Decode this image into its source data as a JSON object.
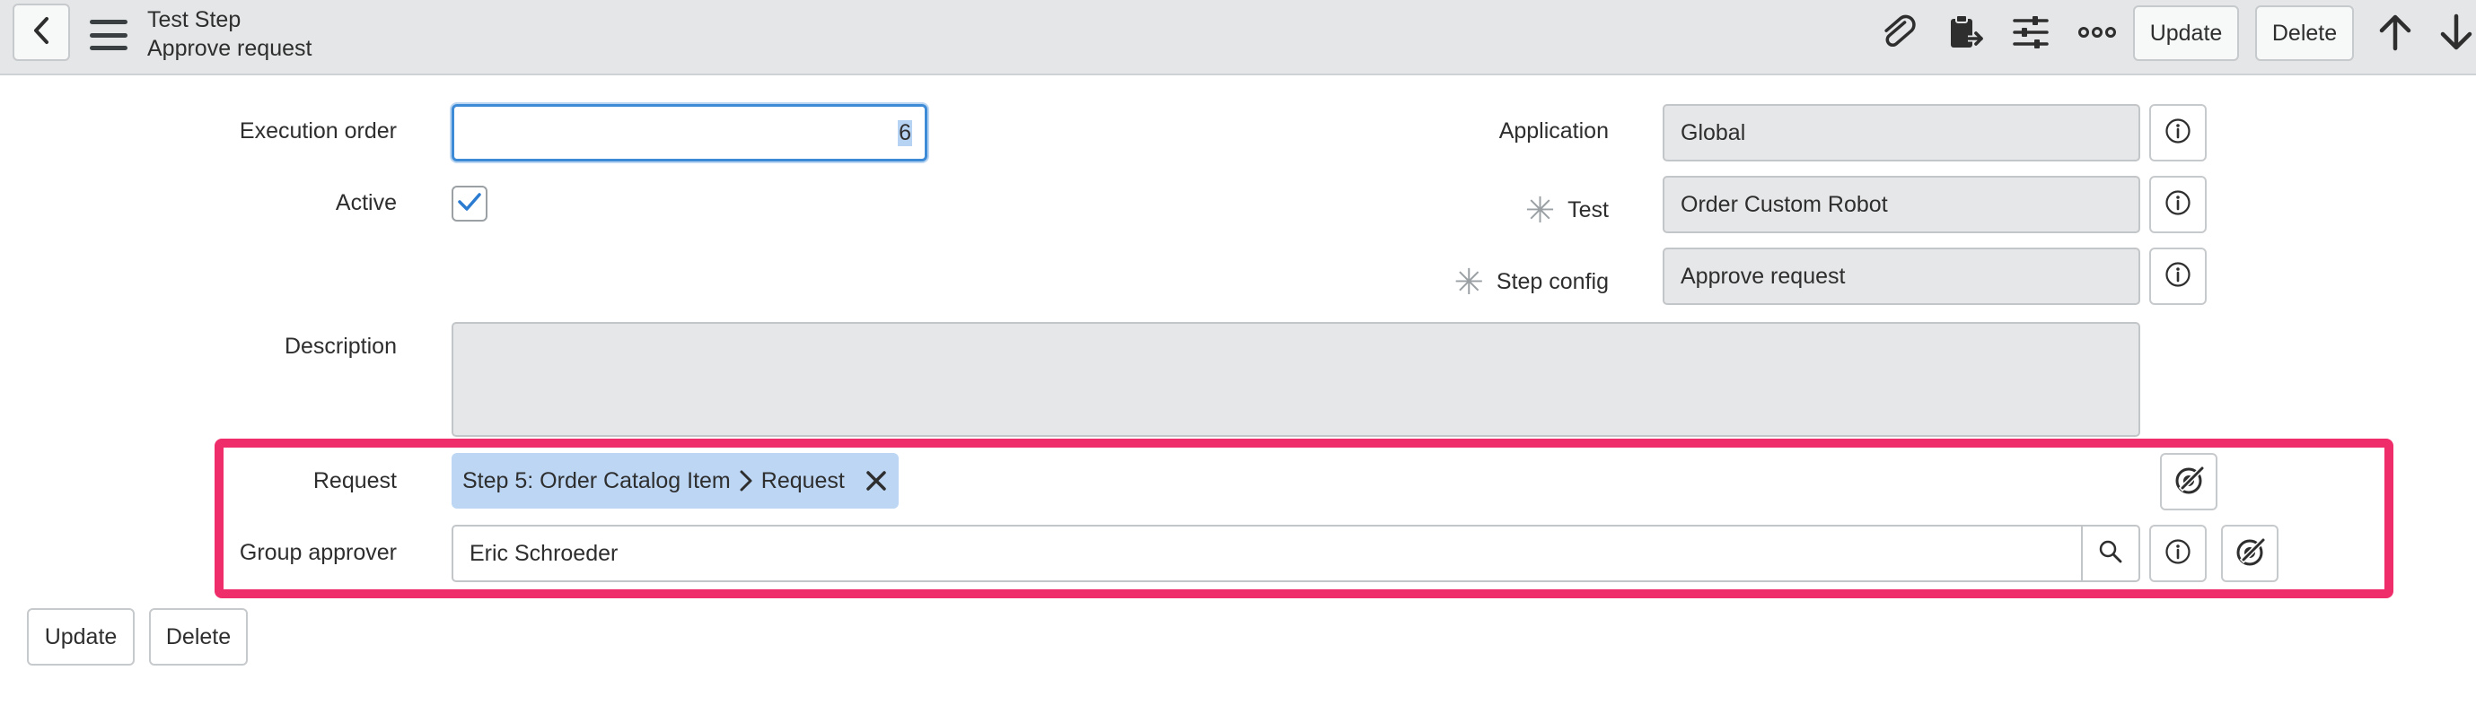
{
  "header": {
    "record_type": "Test Step",
    "record_name": "Approve request",
    "update_label": "Update",
    "delete_label": "Delete"
  },
  "form": {
    "execution_order": {
      "label": "Execution order",
      "value": "6"
    },
    "active": {
      "label": "Active",
      "checked": true
    },
    "application": {
      "label": "Application",
      "value": "Global"
    },
    "test": {
      "label": "Test",
      "value": "Order Custom Robot"
    },
    "step_config": {
      "label": "Step config",
      "value": "Approve request"
    },
    "description": {
      "label": "Description",
      "value": ""
    },
    "request": {
      "label": "Request",
      "pill_step": "Step 5: Order Catalog Item",
      "pill_field": "Request"
    },
    "group_approver": {
      "label": "Group approver",
      "value": "Eric Schroeder"
    }
  },
  "footer": {
    "update_label": "Update",
    "delete_label": "Delete"
  },
  "colors": {
    "highlight_border": "#ef2d6a",
    "focus_blue": "#3d8bd6",
    "pill_bg": "#bcd6f4",
    "header_bg": "#e4e6e7"
  },
  "icons": [
    "back-icon",
    "menu-icon",
    "paperclip-icon",
    "clipboard-icon",
    "settings-sliders-icon",
    "more-icon",
    "arrow-up-icon",
    "arrow-down-icon",
    "info-icon",
    "magnifier-icon",
    "chevron-right-icon",
    "close-icon",
    "dot-walk-icon"
  ]
}
